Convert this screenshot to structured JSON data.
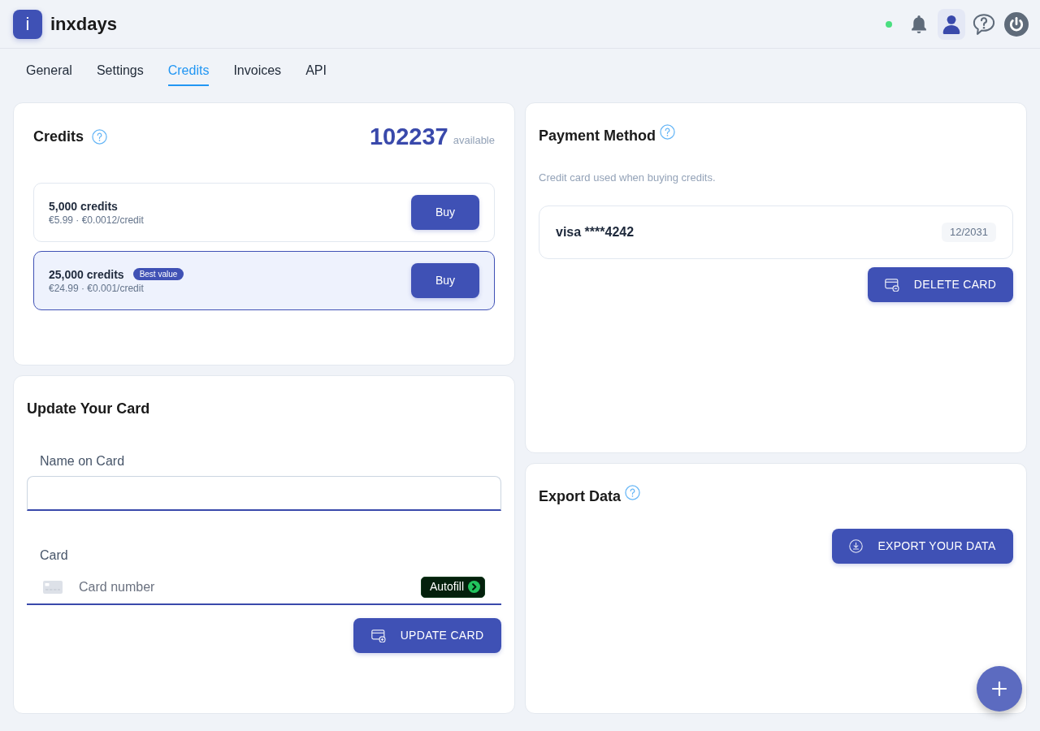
{
  "app": {
    "logo_letter": "i",
    "name": "inxdays"
  },
  "header": {
    "online": true,
    "icons": [
      {
        "kind": "bell",
        "selected": false
      },
      {
        "kind": "user",
        "selected": true
      },
      {
        "kind": "help",
        "selected": false
      },
      {
        "kind": "power",
        "selected": false
      }
    ]
  },
  "tabs": [
    {
      "label": "General",
      "selected": false
    },
    {
      "label": "Settings",
      "selected": false
    },
    {
      "label": "Credits",
      "selected": true
    },
    {
      "label": "Invoices",
      "selected": false
    },
    {
      "label": "API",
      "selected": false
    }
  ],
  "credits": {
    "title": "Credits",
    "balance": "102237",
    "balance_label": "available",
    "packages": [
      {
        "name": "5,000 credits",
        "price": "€5.99 · €0.0012/credit",
        "highlighted": false,
        "button": "Buy"
      },
      {
        "name": "25,000 credits",
        "badge": "Best value",
        "price": "€24.99 · €0.001/credit",
        "highlighted": true,
        "button": "Buy"
      }
    ]
  },
  "update_card": {
    "title": "Update Your Card",
    "name_field": {
      "label": "Name on Card"
    },
    "card_field": {
      "label": "Card",
      "placeholder": "Card number",
      "autofill": "Autofill"
    },
    "button": "UPDATE CARD"
  },
  "payment_method": {
    "title": "Payment Method",
    "description": "Credit card used when buying credits.",
    "card": {
      "label": "visa ****4242",
      "expiry": "12/2031"
    },
    "button": "DELETE CARD"
  },
  "export_data": {
    "title": "Export Data",
    "button": "EXPORT YOUR DATA"
  }
}
